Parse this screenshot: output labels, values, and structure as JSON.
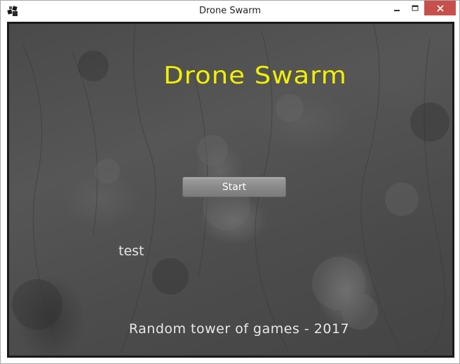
{
  "window": {
    "title": "Drone Swarm",
    "buttons": {
      "minimize_icon": "minimize-icon",
      "maximize_icon": "maximize-icon",
      "close_icon": "close-icon"
    },
    "close_color": "#c7504a"
  },
  "game": {
    "title": "Drone Swarm",
    "title_color": "#f2f000",
    "start_label": "Start",
    "test_label": "test",
    "footer": "Random tower of games - 2017"
  }
}
